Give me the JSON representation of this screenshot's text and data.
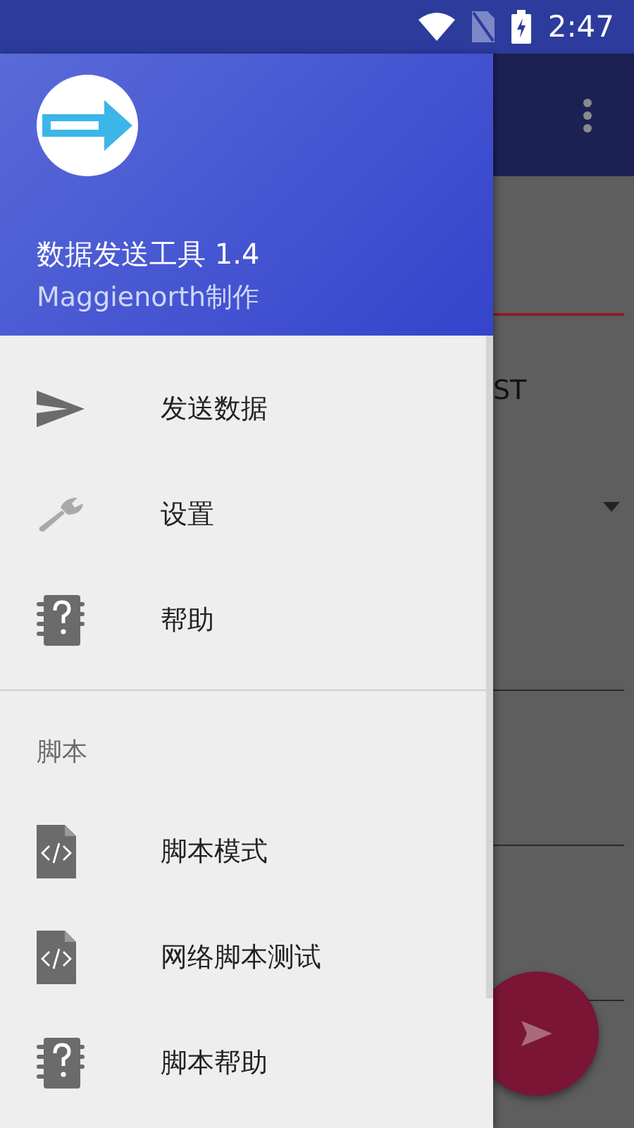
{
  "status_bar": {
    "time": "2:47"
  },
  "drawer": {
    "header": {
      "title": "数据发送工具 1.4",
      "subtitle": "Maggienorth制作"
    },
    "items": [
      {
        "kind": "send",
        "label": "发送数据"
      },
      {
        "kind": "settings",
        "label": "设置"
      },
      {
        "kind": "help",
        "label": "帮助"
      }
    ],
    "section": {
      "title": "脚本",
      "items": [
        {
          "kind": "script",
          "label": "脚本模式"
        },
        {
          "kind": "script",
          "label": "网络脚本测试"
        },
        {
          "kind": "help",
          "label": "脚本帮助"
        }
      ]
    }
  },
  "background": {
    "field_text": "ST"
  }
}
